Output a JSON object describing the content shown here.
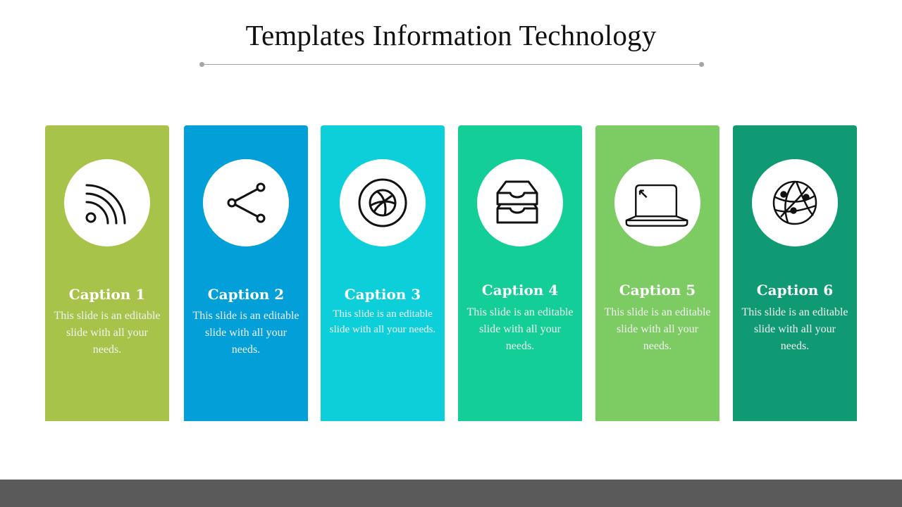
{
  "slide": {
    "title": "Templates Information Technology"
  },
  "cards": [
    {
      "caption": "Caption 1",
      "description": "This slide is an editable slide with all your needs.",
      "icon": "rss-feed-icon",
      "color": "#a8c34a"
    },
    {
      "caption": "Caption 2",
      "description": "This slide is an editable slide with all your needs.",
      "icon": "share-icon",
      "color": "#029fd8"
    },
    {
      "caption": "Caption 3",
      "description": "This slide is an editable slide with all your needs.",
      "icon": "dribbble-ball-icon",
      "color": "#0ccfd9"
    },
    {
      "caption": "Caption 4",
      "description": "This slide is an editable slide with all your needs.",
      "icon": "stacked-trays-icon",
      "color": "#13cf97"
    },
    {
      "caption": "Caption 5",
      "description": "This slide is an editable slide with all your needs.",
      "icon": "laptop-icon",
      "color": "#7dcb63"
    },
    {
      "caption": "Caption 6",
      "description": "This slide is an editable slide with all your needs.",
      "icon": "network-globe-icon",
      "color": "#0f9a74"
    }
  ],
  "colors": {
    "footer": "#5a5a5a",
    "rule": "#a6a6a6"
  }
}
